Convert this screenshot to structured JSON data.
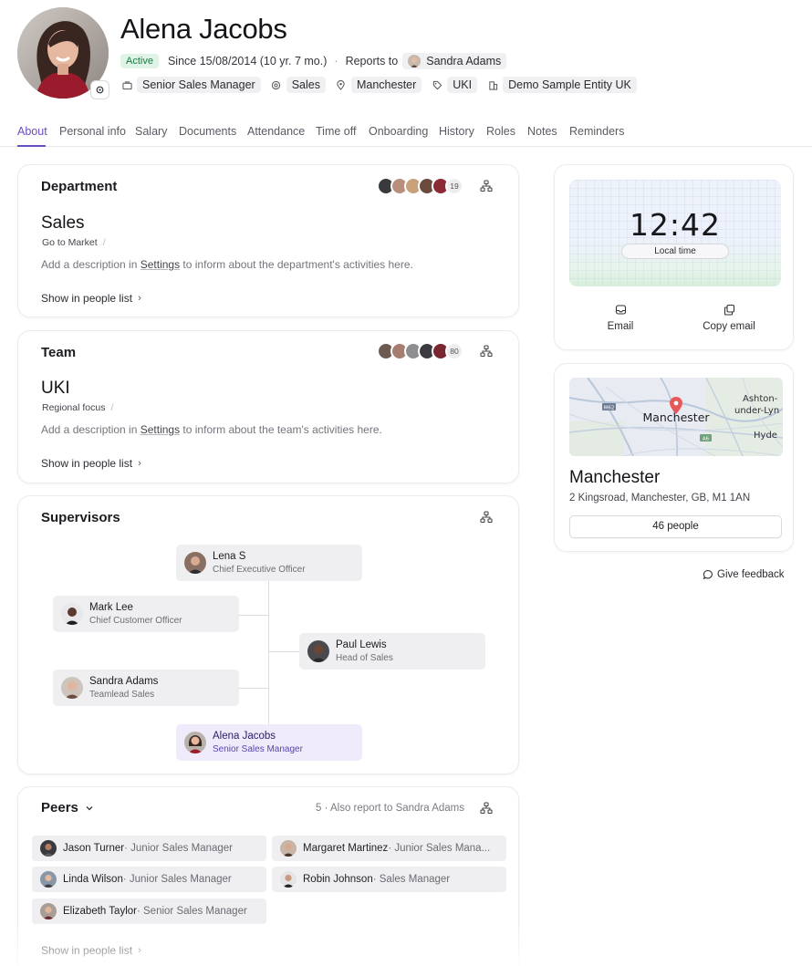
{
  "profile": {
    "name": "Alena Jacobs",
    "status": "Active",
    "since": "Since 15/08/2014 (10 yr. 7 mo.)",
    "reports_to_label": "Reports to",
    "reports_to_name": "Sandra Adams",
    "chips": [
      {
        "label": "Senior Sales Manager",
        "icon": "briefcase-icon"
      },
      {
        "label": "Sales",
        "icon": "target-icon"
      },
      {
        "label": "Manchester",
        "icon": "location-pin-icon"
      },
      {
        "label": "UKI",
        "icon": "tag-icon"
      },
      {
        "label": "Demo Sample Entity UK",
        "icon": "building-icon"
      }
    ]
  },
  "tabs": [
    "About",
    "Personal info",
    "Salary",
    "Documents",
    "Attendance",
    "Time off",
    "Onboarding",
    "History",
    "Roles",
    "Notes",
    "Reminders"
  ],
  "active_tab": "About",
  "department": {
    "card_title": "Department",
    "member_count": "19",
    "name": "Sales",
    "subtitle": "Go to Market",
    "description_pre": "Add a description in ",
    "description_link": "Settings",
    "description_post": " to inform about the department's activities here.",
    "show_link": "Show in people list"
  },
  "team": {
    "card_title": "Team",
    "member_count": "80",
    "name": "UKI",
    "subtitle": "Regional focus",
    "description_pre": "Add a description in ",
    "description_link": "Settings",
    "description_post": " to inform about the team's activities here.",
    "show_link": "Show in people list"
  },
  "supervisors": {
    "card_title": "Supervisors",
    "nodes": [
      {
        "name": "Lena S",
        "role": "Chief Executive Officer"
      },
      {
        "name": "Mark Lee",
        "role": "Chief Customer Officer"
      },
      {
        "name": "Paul Lewis",
        "role": "Head of Sales"
      },
      {
        "name": "Sandra Adams",
        "role": "Teamlead Sales"
      },
      {
        "name": "Alena Jacobs",
        "role": "Senior Sales Manager"
      }
    ]
  },
  "peers": {
    "card_title": "Peers",
    "summary": "5 · Also report to Sandra Adams",
    "list": [
      {
        "name": "Jason Turner",
        "role": " · Junior Sales Manager"
      },
      {
        "name": "Margaret Martinez",
        "role": " · Junior Sales Mana..."
      },
      {
        "name": "Linda Wilson",
        "role": " · Junior Sales Manager"
      },
      {
        "name": "Robin Johnson",
        "role": " · Sales Manager"
      },
      {
        "name": "Elizabeth Taylor",
        "role": " · Senior Sales Manager"
      }
    ],
    "show_link": "Show in people list"
  },
  "contact": {
    "time": "12:42",
    "time_label": "Local time",
    "email_label": "Email",
    "copy_email_label": "Copy email"
  },
  "location": {
    "map_labels": {
      "city": "Manchester",
      "town1": "Ashton-",
      "town1b": "under-Lyn",
      "town2": "Hyde",
      "road1": "M62",
      "road2": "A6"
    },
    "city": "Manchester",
    "address": "2 Kingsroad, Manchester, GB, M1 1AN",
    "people_button": "46 people"
  },
  "feedback_label": "Give feedback",
  "colors": {
    "accent": "#6a4ec2",
    "active_badge_bg": "#dff3e6",
    "active_badge_text": "#1e7a43"
  }
}
